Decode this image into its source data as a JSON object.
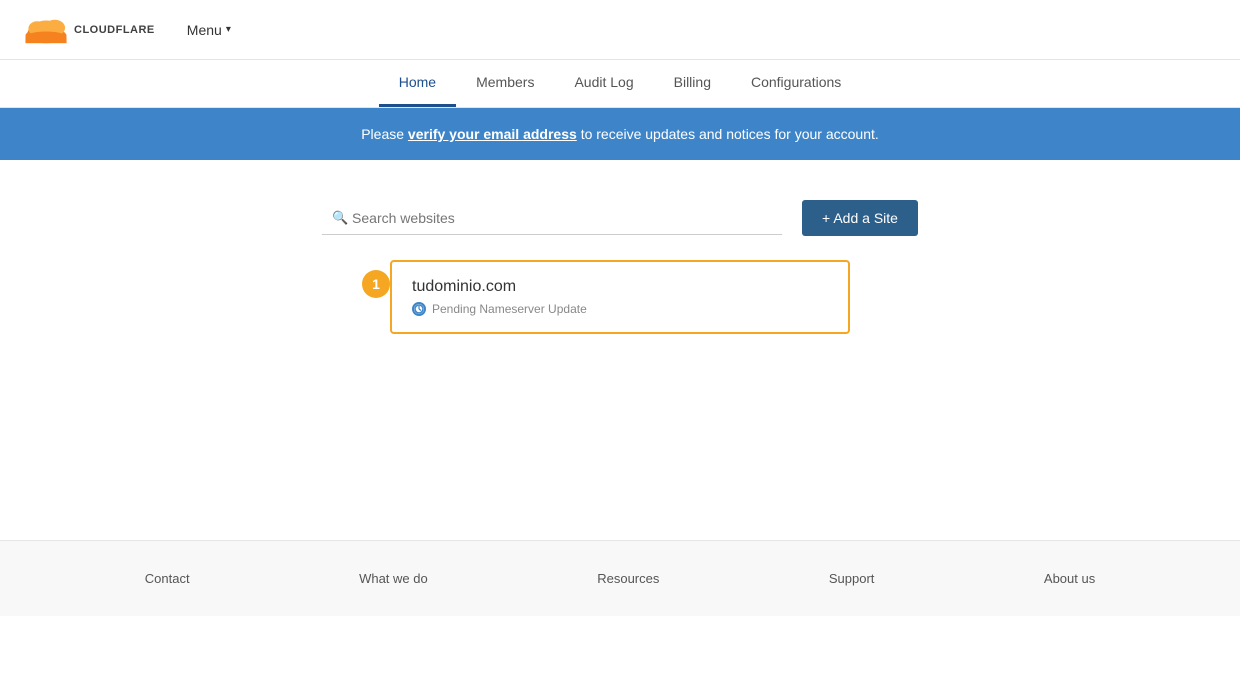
{
  "header": {
    "logo_text": "CLOUDFLARE",
    "menu_label": "Menu",
    "chevron": "▾"
  },
  "nav": {
    "tabs": [
      {
        "label": "Home",
        "active": true
      },
      {
        "label": "Members",
        "active": false
      },
      {
        "label": "Audit Log",
        "active": false
      },
      {
        "label": "Billing",
        "active": false
      },
      {
        "label": "Configurations",
        "active": false
      }
    ]
  },
  "banner": {
    "text_before": "Please ",
    "link_text": "verify your email address",
    "text_after": " to receive updates and notices for your account."
  },
  "main": {
    "search_placeholder": "Search websites",
    "add_site_label": "+ Add a Site",
    "badge_number": "1",
    "site": {
      "domain": "tudominio.com",
      "status": "Pending Nameserver Update"
    }
  },
  "footer": {
    "links": [
      {
        "label": "Contact"
      },
      {
        "label": "What we do"
      },
      {
        "label": "Resources"
      },
      {
        "label": "Support"
      },
      {
        "label": "About us"
      }
    ]
  }
}
